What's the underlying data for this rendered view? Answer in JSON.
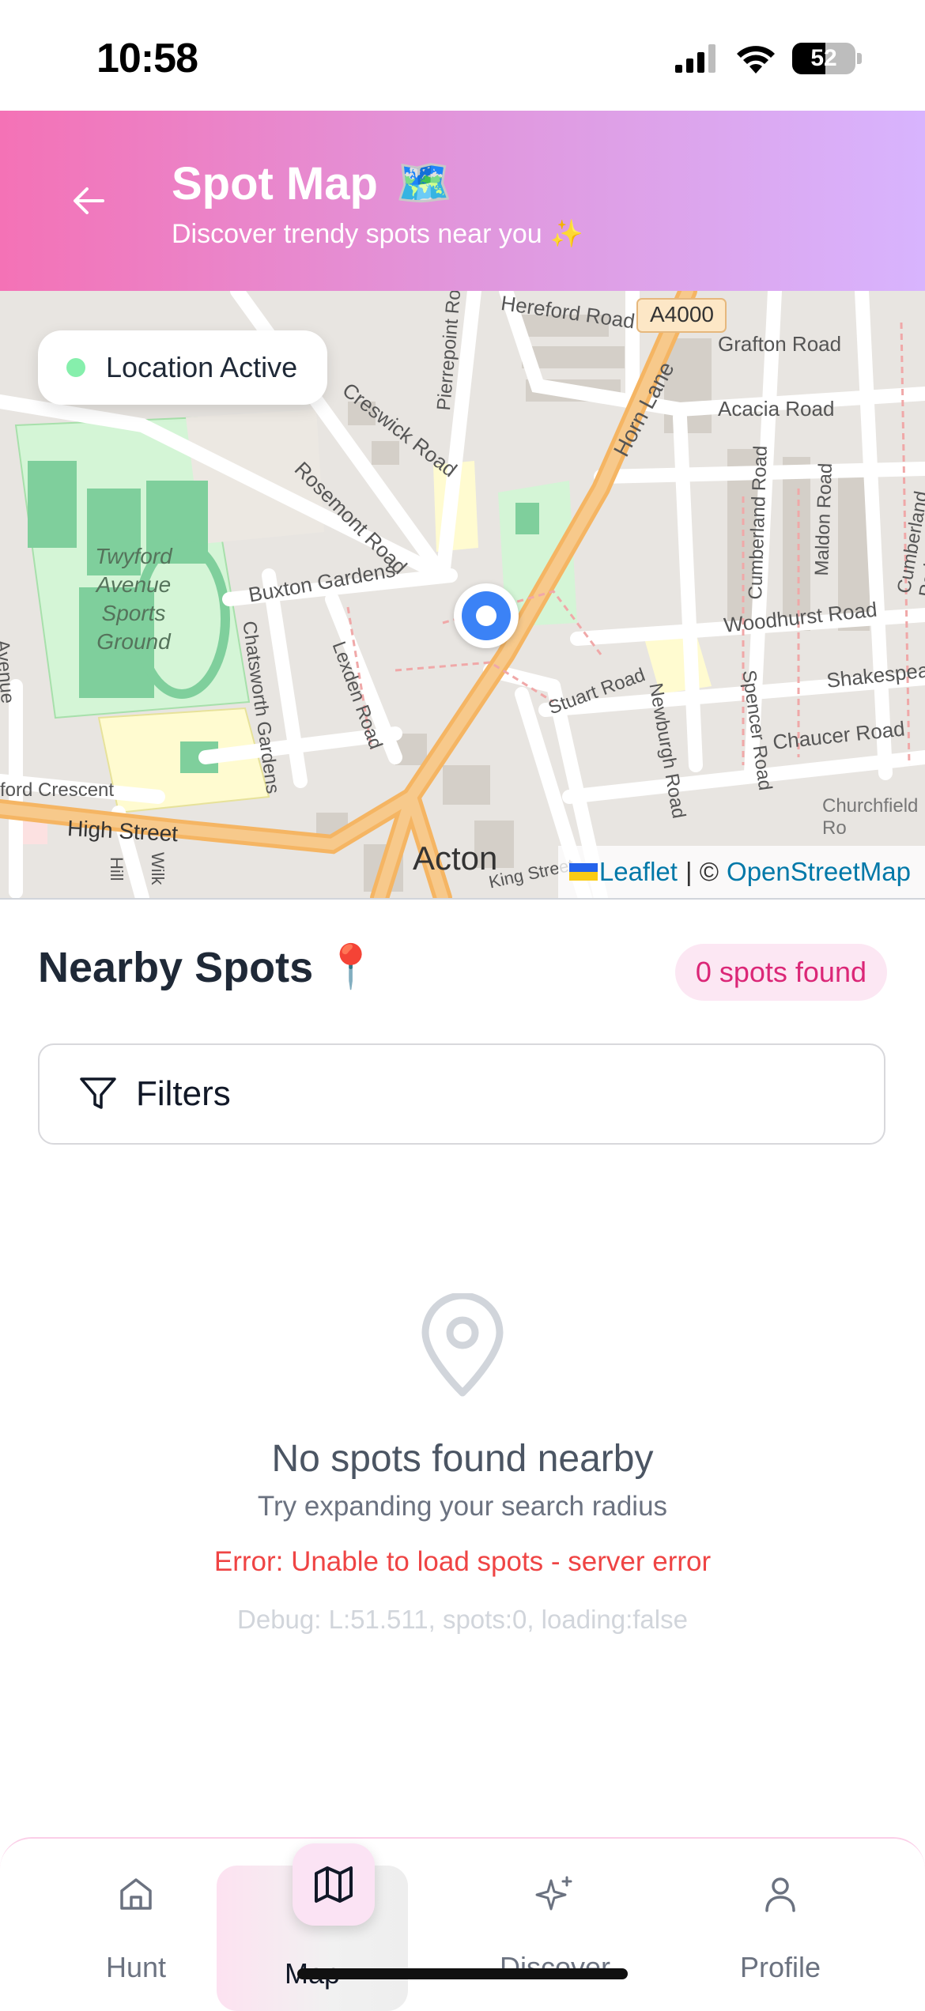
{
  "status_bar": {
    "time": "10:58",
    "battery": "52"
  },
  "header": {
    "title": "Spot Map",
    "title_emoji": "🗺️",
    "subtitle": "Discover trendy spots near you",
    "subtitle_emoji": "✨"
  },
  "map": {
    "location_status": "Location Active",
    "labels": {
      "hereford": "Hereford Road",
      "a4000": "A4000",
      "grafton": "Grafton Road",
      "acacia": "Acacia Road",
      "horn": "Horn Lane",
      "creswick": "Creswick Road",
      "pierrepoint": "Pierrepoint Road",
      "rosemont": "Rosemont Road",
      "twyford": "Twyford Avenue Sports Ground",
      "buxton": "Buxton Gardens",
      "cumberland": "Cumberland Road",
      "maldon": "Maldon Road",
      "cumberland_park": "Cumberland Park",
      "woodhurst": "Woodhurst Road",
      "shakespeare": "Shakespear",
      "chatsworth": "Chatsworth Gardens",
      "lexden": "Lexden Road",
      "stuart": "Stuart Road",
      "newburgh": "Newburgh Road",
      "spencer": "Spencer Road",
      "chaucer": "Chaucer Road",
      "ford_crescent": "ford Crescent",
      "high_street": "High Street",
      "acton": "Acton",
      "king_st": "King Street",
      "churchfield": "Churchfield Ro",
      "avenue": "Avenue",
      "hill": "Hill",
      "wilk": "Wilk"
    },
    "attribution": {
      "leaflet": "Leaflet",
      "separator": "| ©",
      "osm": "OpenStreetMap"
    }
  },
  "nearby": {
    "title": "Nearby Spots",
    "title_emoji": "📍",
    "count_label": "0 spots found",
    "filters_label": "Filters"
  },
  "empty_state": {
    "title": "No spots found nearby",
    "subtitle": "Try expanding your search radius",
    "error": "Error: Unable to load spots - server error",
    "debug": "Debug: L:51.511, spots:0, loading:false"
  },
  "nav": {
    "items": [
      {
        "label": "Hunt",
        "icon": "home-icon"
      },
      {
        "label": "Map",
        "icon": "map-icon",
        "active": true
      },
      {
        "label": "Discover",
        "icon": "sparkles-icon"
      },
      {
        "label": "Profile",
        "icon": "user-icon"
      }
    ]
  },
  "colors": {
    "accent_pink": "#f472b6",
    "accent_purple": "#d8b4fe",
    "error": "#ef4444",
    "location_marker": "#3b82f6"
  }
}
